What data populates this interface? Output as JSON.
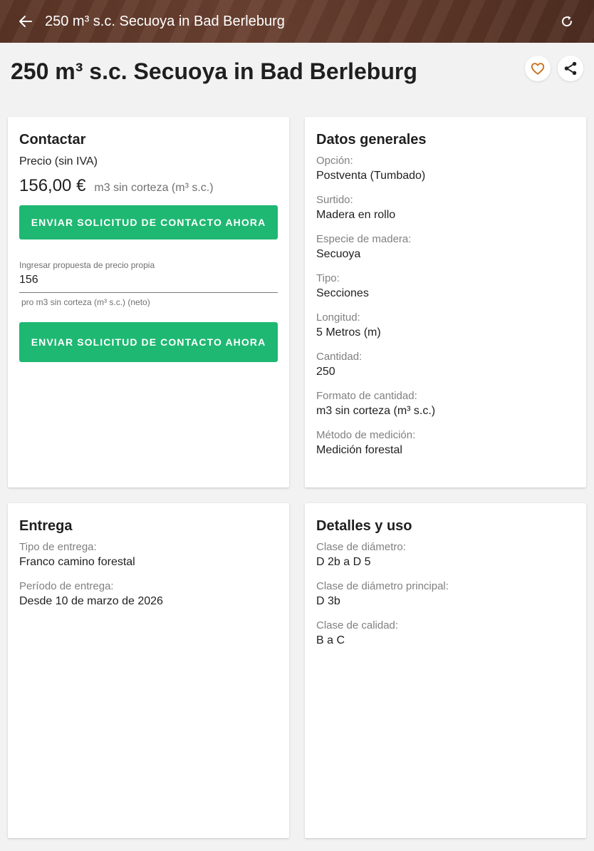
{
  "appbar": {
    "title": "250 m³ s.c. Secuoya in Bad Berleburg"
  },
  "page": {
    "title": "250 m³ s.c. Secuoya in Bad Berleburg"
  },
  "contact": {
    "heading": "Contactar",
    "price_label": "Precio (sin IVA)",
    "price": "156,00 €",
    "price_unit": "m3 sin corteza (m³ s.c.)",
    "cta_label": "ENVIAR SOLICITUD DE CONTACTO AHORA",
    "input_label": "Ingresar propuesta de precio propia",
    "input_value": "156",
    "input_hint": "pro m3 sin corteza (m³ s.c.) (neto)",
    "cta2_label": "ENVIAR SOLICITUD DE CONTACTO AHORA"
  },
  "general": {
    "heading": "Datos generales",
    "fields": [
      {
        "label": "Opción:",
        "value": "Postventa (Tumbado)"
      },
      {
        "label": "Surtido:",
        "value": "Madera en rollo"
      },
      {
        "label": "Especie de madera:",
        "value": "Secuoya"
      },
      {
        "label": "Tipo:",
        "value": "Secciones"
      },
      {
        "label": "Longitud:",
        "value": "5 Metros (m)"
      },
      {
        "label": "Cantidad:",
        "value": "250"
      },
      {
        "label": "Formato de cantidad:",
        "value": "m3 sin corteza (m³ s.c.)"
      },
      {
        "label": "Método de medición:",
        "value": "Medición forestal"
      }
    ]
  },
  "delivery": {
    "heading": "Entrega",
    "fields": [
      {
        "label": "Tipo de entrega:",
        "value": "Franco camino forestal"
      },
      {
        "label": "Período de entrega:",
        "value": "Desde 10 de marzo de 2026"
      }
    ]
  },
  "details": {
    "heading": "Detalles y uso",
    "fields": [
      {
        "label": "Clase de diámetro:",
        "value": "D 2b a D 5"
      },
      {
        "label": "Clase de diámetro principal:",
        "value": "D 3b"
      },
      {
        "label": "Clase de calidad:",
        "value": "B a C"
      }
    ]
  },
  "icons": {
    "back": "arrow-left-icon",
    "refresh": "refresh-icon",
    "favorite": "heart-outline-icon",
    "share": "share-icon"
  },
  "colors": {
    "appbar": "#5a3526",
    "cta": "#1eb872",
    "favorite": "#c8701e",
    "background": "#f2f2f2"
  }
}
